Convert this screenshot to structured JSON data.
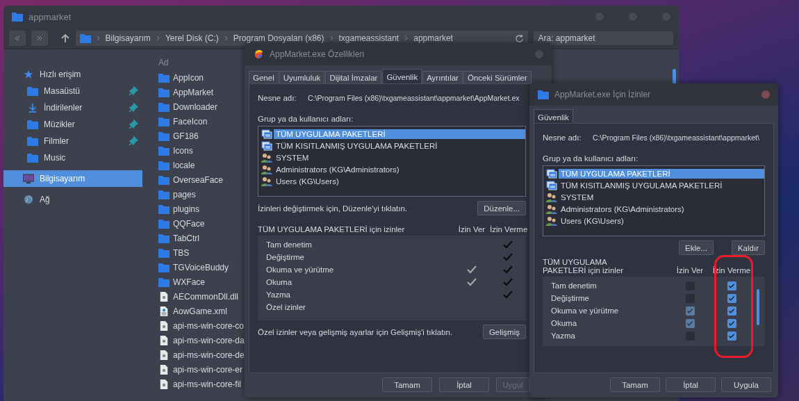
{
  "explorer": {
    "title": "appmarket",
    "breadcrumbs": [
      "Bilgisayarım",
      "Yerel Disk (C:)",
      "Program Dosyaları (x86)",
      "txgameassistant",
      "appmarket"
    ],
    "search": {
      "placeholder": "Ara: appmarket"
    },
    "sidebar": {
      "items": [
        {
          "label": "Hızlı erişim",
          "kind": "star",
          "selected": false,
          "children": [
            {
              "label": "Masaüstü",
              "kind": "folder",
              "pinned": true,
              "selected": false
            },
            {
              "label": "İndirilenler",
              "kind": "download",
              "pinned": true,
              "selected": false
            },
            {
              "label": "Müzikler",
              "kind": "folder",
              "pinned": true,
              "selected": false
            },
            {
              "label": "Filmler",
              "kind": "folder",
              "pinned": true,
              "selected": false
            },
            {
              "label": "Music",
              "kind": "folder",
              "pinned": false,
              "selected": false
            }
          ]
        },
        {
          "label": "Bilgisayarım",
          "kind": "computer",
          "selected": true
        },
        {
          "label": "Ağ",
          "kind": "globe",
          "selected": false
        }
      ]
    },
    "file_list": {
      "column": "Ad",
      "files": [
        {
          "name": "AppIcon",
          "kind": "folder"
        },
        {
          "name": "AppMarket",
          "kind": "folder"
        },
        {
          "name": "Downloader",
          "kind": "folder"
        },
        {
          "name": "FaceIcon",
          "kind": "folder"
        },
        {
          "name": "GF186",
          "kind": "folder"
        },
        {
          "name": "Icons",
          "kind": "folder"
        },
        {
          "name": "locale",
          "kind": "folder"
        },
        {
          "name": "OverseaFace",
          "kind": "folder"
        },
        {
          "name": "pages",
          "kind": "folder"
        },
        {
          "name": "plugins",
          "kind": "folder"
        },
        {
          "name": "QQFace",
          "kind": "folder"
        },
        {
          "name": "TabCtrl",
          "kind": "folder"
        },
        {
          "name": "TBS",
          "kind": "folder"
        },
        {
          "name": "TGVoiceBuddy",
          "kind": "folder"
        },
        {
          "name": "WXFace",
          "kind": "folder"
        },
        {
          "name": "AECommonDll.dll",
          "kind": "dll"
        },
        {
          "name": "AowGame.xml",
          "kind": "xml"
        },
        {
          "name": "api-ms-win-core-co",
          "kind": "dll"
        },
        {
          "name": "api-ms-win-core-da",
          "kind": "dll"
        },
        {
          "name": "api-ms-win-core-de",
          "kind": "dll"
        },
        {
          "name": "api-ms-win-core-er",
          "kind": "dll"
        },
        {
          "name": "api-ms-win-core-fil",
          "kind": "dll"
        }
      ]
    }
  },
  "properties_dialog": {
    "title": "AppMarket.exe Özellikleri",
    "tabs": [
      {
        "label": "Genel",
        "selected": false
      },
      {
        "label": "Uyumluluk",
        "selected": false
      },
      {
        "label": "Dijital İmzalar",
        "selected": false
      },
      {
        "label": "Güvenlik",
        "selected": true
      },
      {
        "label": "Ayrıntılar",
        "selected": false
      },
      {
        "label": "Önceki Sürümler",
        "selected": false
      }
    ],
    "object_label": "Nesne adı:",
    "object_path": "C:\\Program Files (x86)\\txgameassistant\\appmarket\\AppMarket.ex",
    "groups_label": "Grup ya da kullanıcı adları:",
    "groups": [
      {
        "name": "TÜM UYGULAMA PAKETLERİ",
        "kind": "package",
        "selected": true
      },
      {
        "name": "TÜM KISITLANMIŞ UYGULAMA PAKETLERİ",
        "kind": "package",
        "selected": false
      },
      {
        "name": "SYSTEM",
        "kind": "users",
        "selected": false
      },
      {
        "name": "Administrators (KG\\Administrators)",
        "kind": "users",
        "selected": false
      },
      {
        "name": "Users (KG\\Users)",
        "kind": "users",
        "selected": false
      }
    ],
    "edit_hint": "İzinleri değiştirmek için, Düzenle'yi tıklatın.",
    "edit_button": "Düzenle...",
    "permissions_heading": "TÜM UYGULAMA PAKETLERİ için izinler",
    "allow_header": "İzin Ver",
    "deny_header": "İzin Verme",
    "permissions": [
      {
        "name": "Tam denetim",
        "allow": false,
        "deny": true
      },
      {
        "name": "Değiştirme",
        "allow": false,
        "deny": true
      },
      {
        "name": "Okuma ve yürütme",
        "allow": true,
        "deny": true
      },
      {
        "name": "Okuma",
        "allow": true,
        "deny": true
      },
      {
        "name": "Yazma",
        "allow": false,
        "deny": true
      },
      {
        "name": "Özel izinler",
        "allow": false,
        "deny": false
      }
    ],
    "advanced_hint": "Özel izinler veya gelişmiş ayarlar için Gelişmiş'i tıklatın.",
    "advanced_button": "Gelişmiş",
    "buttons": [
      {
        "label": "Tamam",
        "disabled": false
      },
      {
        "label": "İptal",
        "disabled": false
      },
      {
        "label": "Uygul",
        "disabled": true
      }
    ]
  },
  "permissions_dialog": {
    "title": "AppMarket.exe İçin İzinler",
    "tabs": [
      {
        "label": "Güvenlik",
        "selected": true
      }
    ],
    "object_label": "Nesne adı:",
    "object_path": "C:\\Program Files (x86)\\txgameassistant\\appmarket\\",
    "groups_label": "Grup ya da kullanıcı adları:",
    "groups": [
      {
        "name": "TÜM UYGULAMA PAKETLERİ",
        "kind": "package",
        "selected": true
      },
      {
        "name": "TÜM KISITLANMIŞ UYGULAMA PAKETLERİ",
        "kind": "package",
        "selected": false
      },
      {
        "name": "SYSTEM",
        "kind": "users",
        "selected": false
      },
      {
        "name": "Administrators (KG\\Administrators)",
        "kind": "users",
        "selected": false
      },
      {
        "name": "Users (KG\\Users)",
        "kind": "users",
        "selected": false
      }
    ],
    "add_button": "Ekle...",
    "remove_button": "Kaldır",
    "permissions_heading": "TÜM UYGULAMA PAKETLERİ için izinler",
    "allow_header": "İzin Ver",
    "deny_header": "İzin Verme",
    "permissions": [
      {
        "name": "Tam denetim",
        "allow": false,
        "deny": true
      },
      {
        "name": "Değiştirme",
        "allow": false,
        "deny": true
      },
      {
        "name": "Okuma ve yürütme",
        "allow": true,
        "deny": true
      },
      {
        "name": "Okuma",
        "allow": true,
        "deny": true
      },
      {
        "name": "Yazma",
        "allow": false,
        "deny": true
      }
    ],
    "buttons": [
      {
        "label": "Tamam",
        "disabled": false
      },
      {
        "label": "İptal",
        "disabled": false
      },
      {
        "label": "Uygula",
        "disabled": false
      }
    ]
  }
}
